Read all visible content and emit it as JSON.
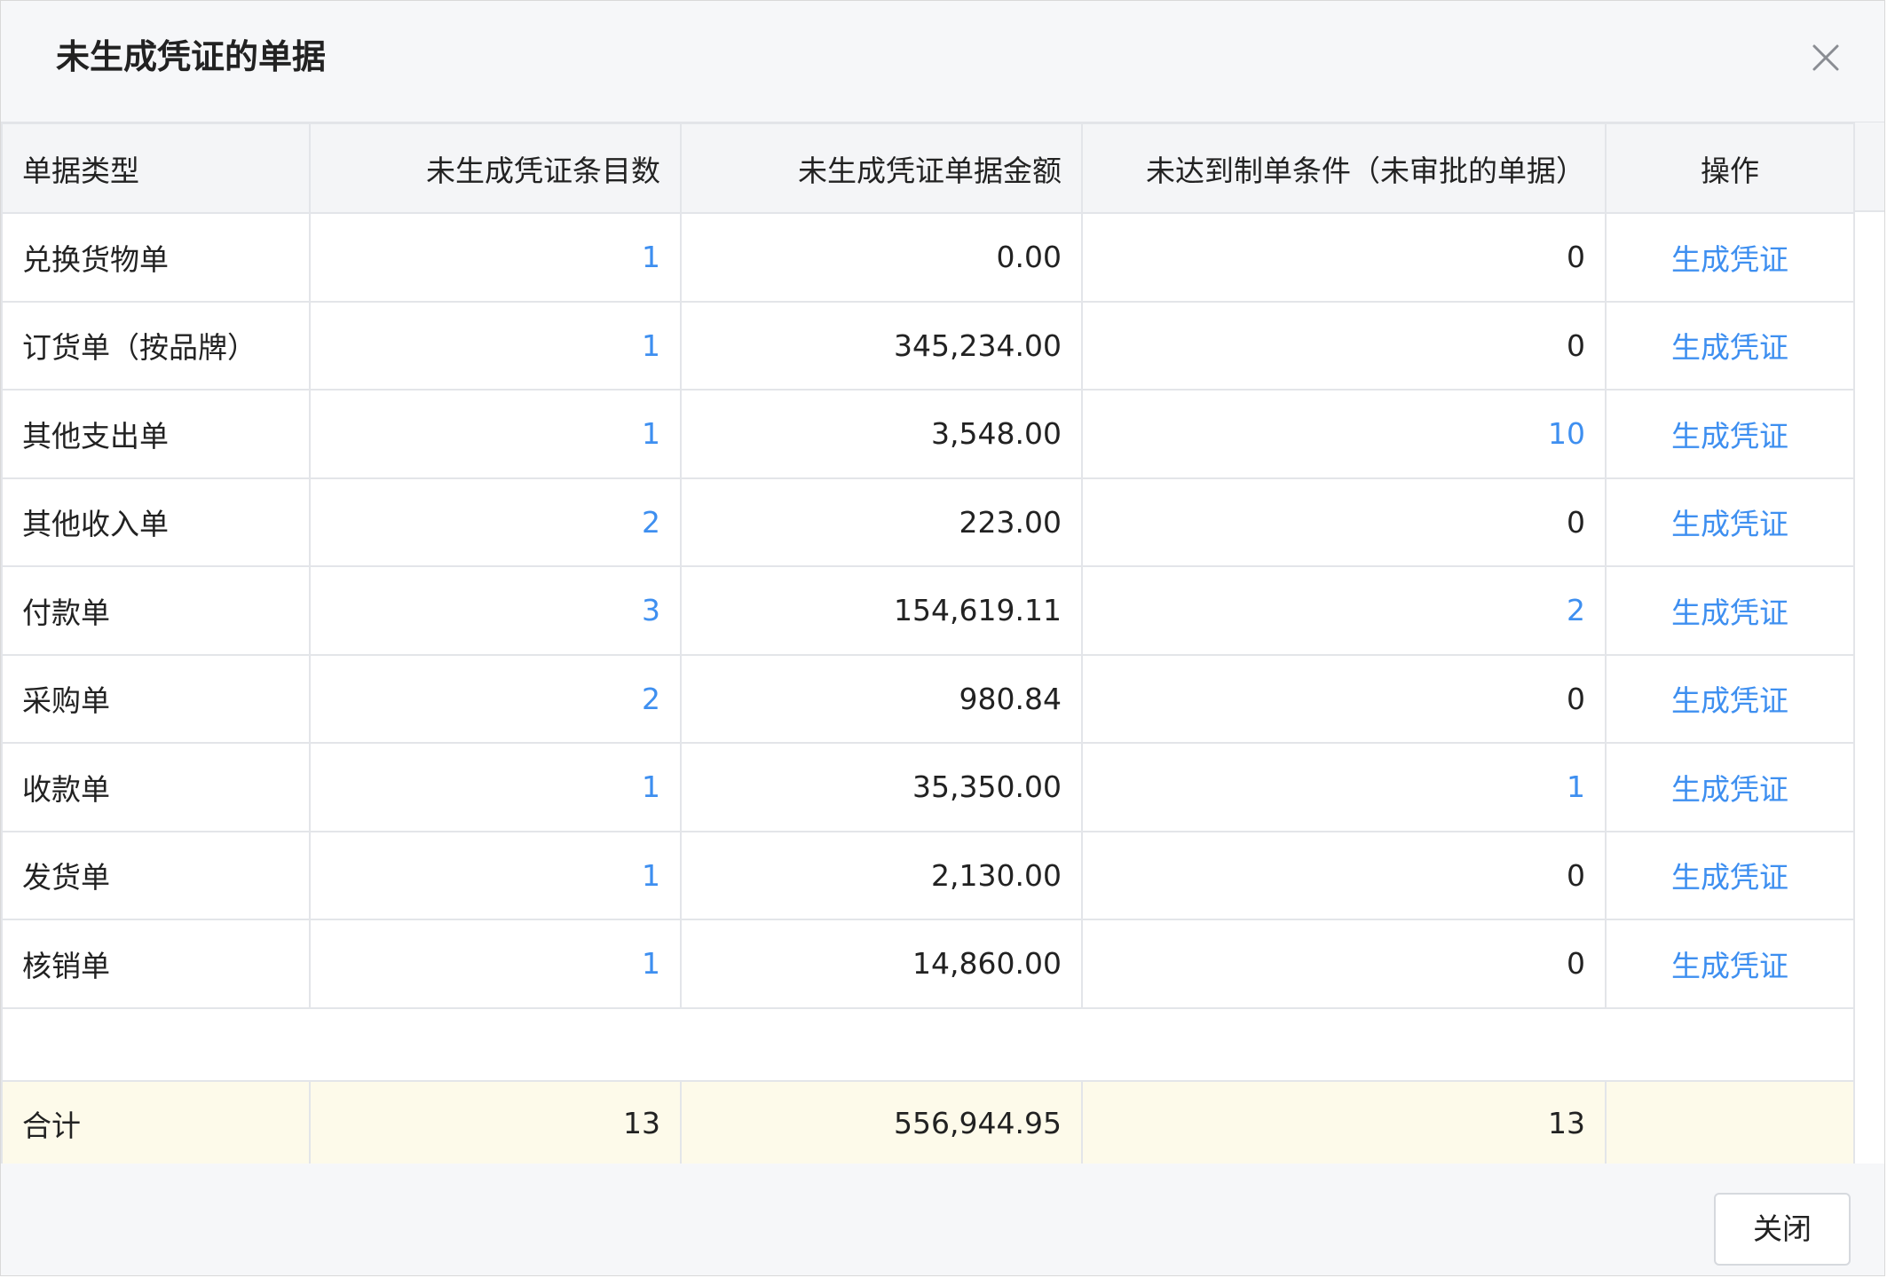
{
  "dialog": {
    "title": "未生成凭证的单据",
    "close_icon": "close-icon"
  },
  "table": {
    "headers": [
      "单据类型",
      "未生成凭证条目数",
      "未生成凭证单据金额",
      "未达到制单条件（未审批的单据）",
      "操作"
    ],
    "rows": [
      {
        "type": "兑换货物单",
        "count": "1",
        "amount": "0.00",
        "unapproved": "0",
        "action": "生成凭证"
      },
      {
        "type": "订货单（按品牌）",
        "count": "1",
        "amount": "345,234.00",
        "unapproved": "0",
        "action": "生成凭证"
      },
      {
        "type": "其他支出单",
        "count": "1",
        "amount": "3,548.00",
        "unapproved": "10",
        "action": "生成凭证"
      },
      {
        "type": "其他收入单",
        "count": "2",
        "amount": "223.00",
        "unapproved": "0",
        "action": "生成凭证"
      },
      {
        "type": "付款单",
        "count": "3",
        "amount": "154,619.11",
        "unapproved": "2",
        "action": "生成凭证"
      },
      {
        "type": "采购单",
        "count": "2",
        "amount": "980.84",
        "unapproved": "0",
        "action": "生成凭证"
      },
      {
        "type": "收款单",
        "count": "1",
        "amount": "35,350.00",
        "unapproved": "1",
        "action": "生成凭证"
      },
      {
        "type": "发货单",
        "count": "1",
        "amount": "2,130.00",
        "unapproved": "0",
        "action": "生成凭证"
      },
      {
        "type": "核销单",
        "count": "1",
        "amount": "14,860.00",
        "unapproved": "0",
        "action": "生成凭证"
      }
    ],
    "total": {
      "label": "合计",
      "count": "13",
      "amount": "556,944.95",
      "unapproved": "13"
    }
  },
  "footer": {
    "close_label": "关闭"
  },
  "colors": {
    "link": "#3e8ff0",
    "total_row_bg": "#fdfaea",
    "header_bg": "#f4f5f7"
  }
}
